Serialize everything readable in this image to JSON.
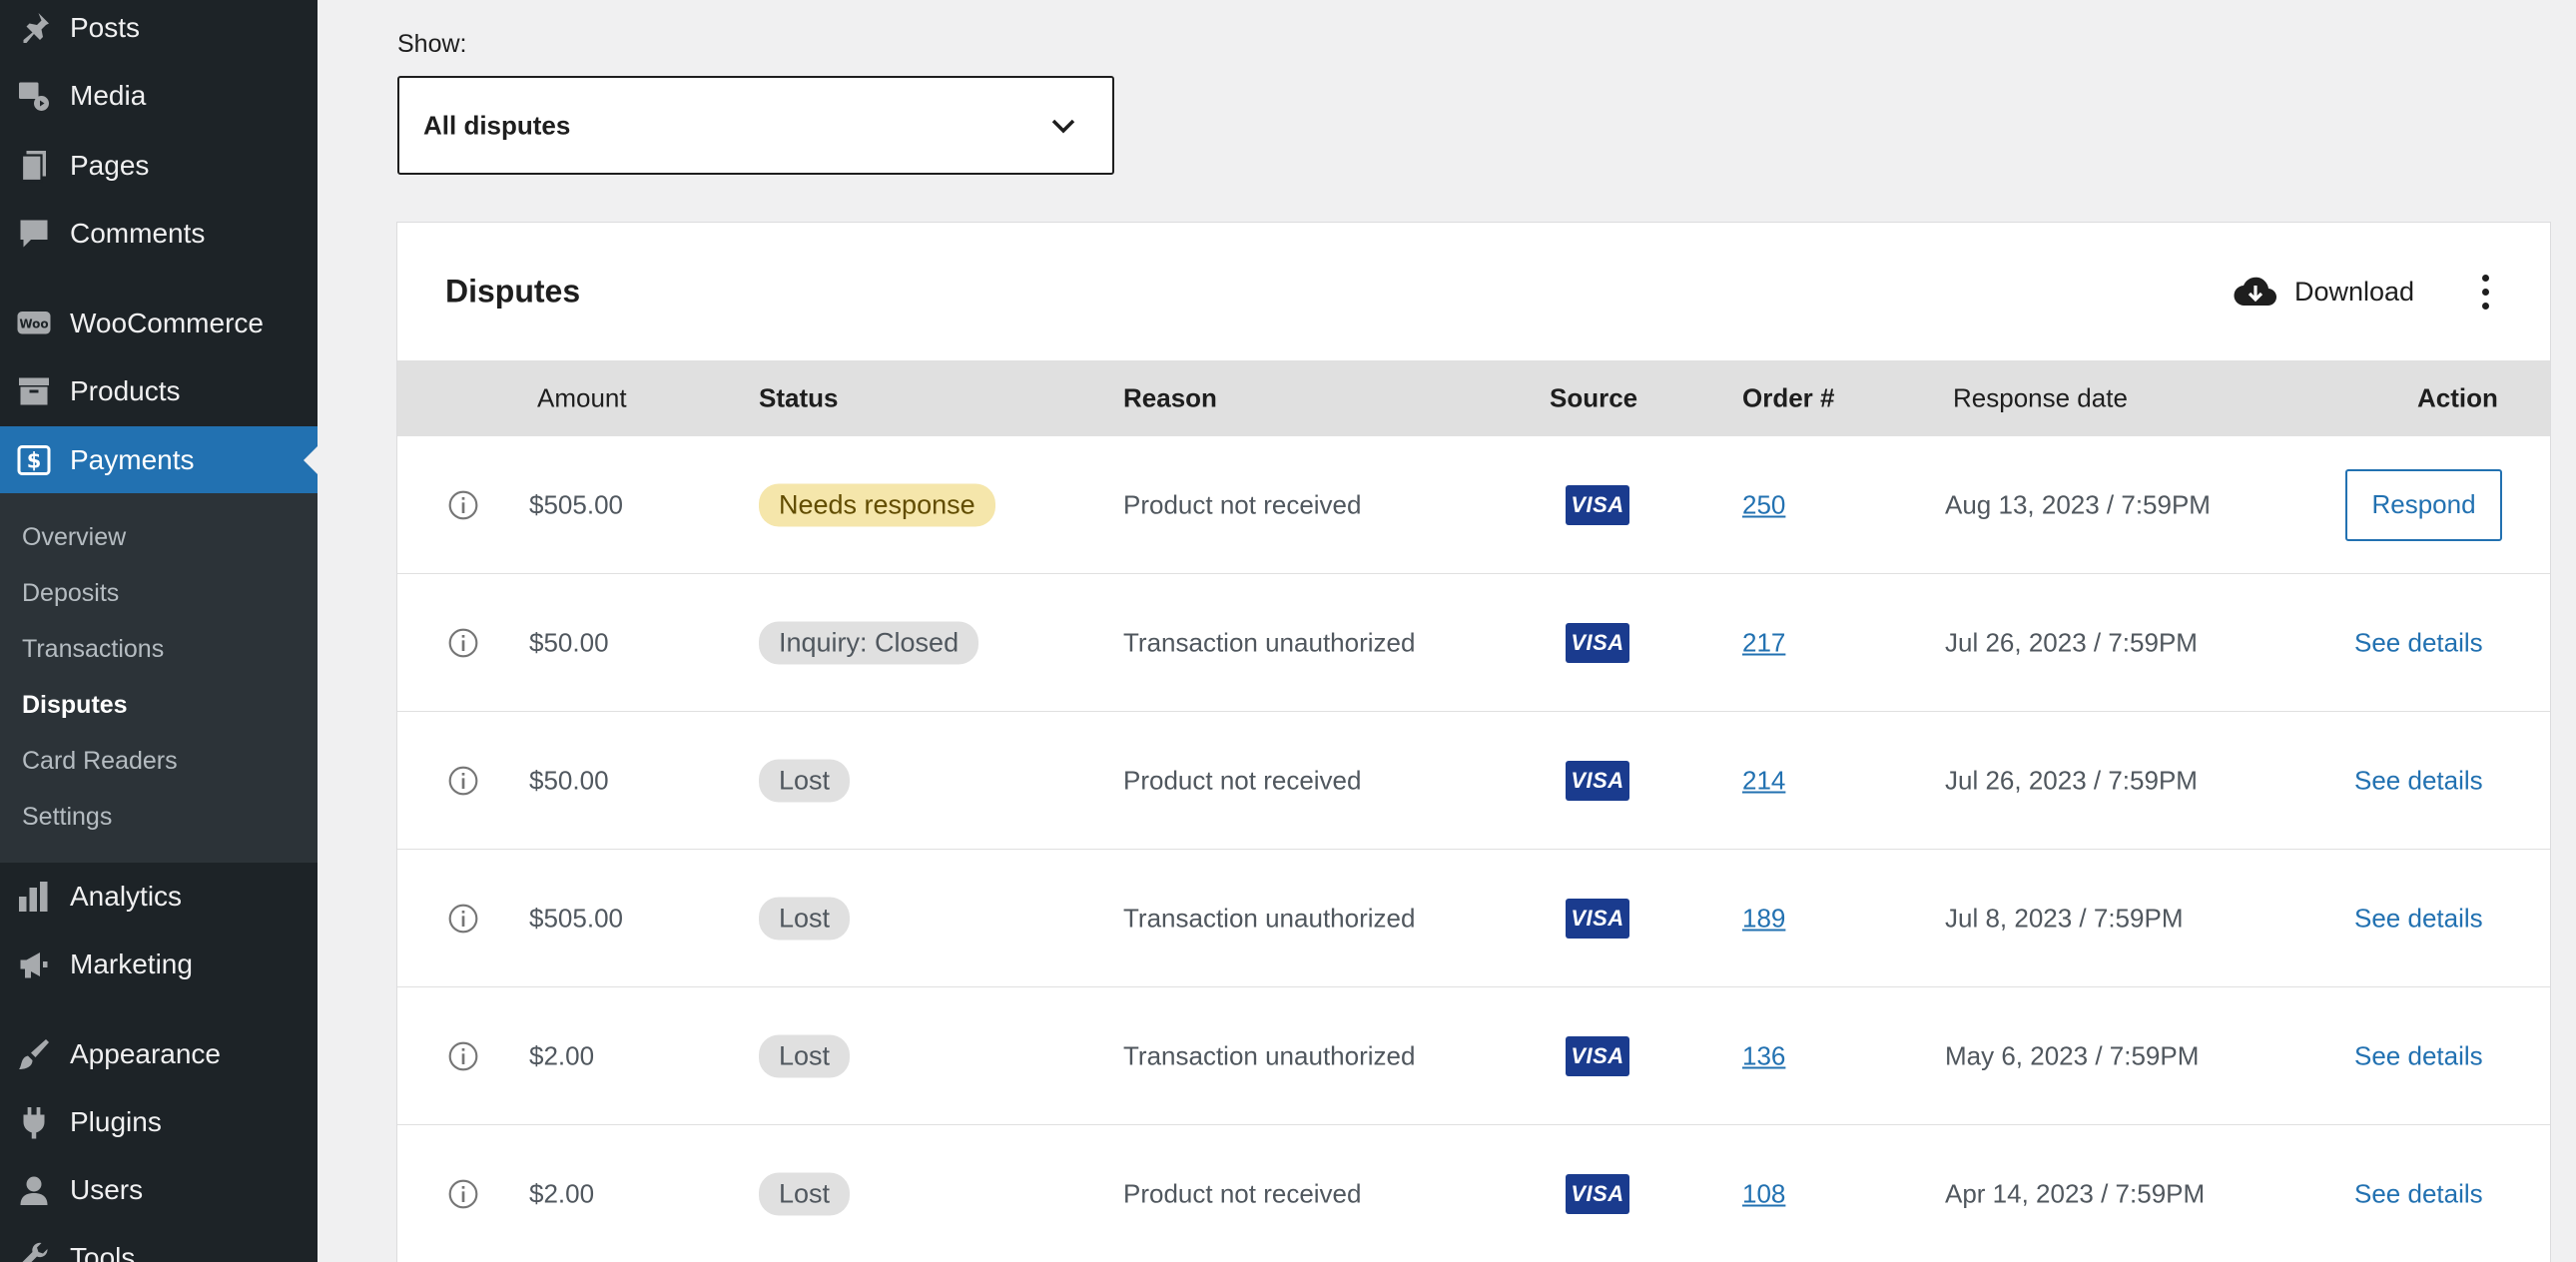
{
  "sidebar": {
    "menu": [
      {
        "label": "Posts",
        "icon": "pin-icon"
      },
      {
        "label": "Media",
        "icon": "media-icon"
      },
      {
        "label": "Pages",
        "icon": "pages-icon"
      },
      {
        "label": "Comments",
        "icon": "comment-icon"
      },
      {
        "label": "WooCommerce",
        "icon": "woo-icon"
      },
      {
        "label": "Products",
        "icon": "archive-icon"
      },
      {
        "label": "Payments",
        "icon": "dollar-icon"
      },
      {
        "label": "Analytics",
        "icon": "bar-chart-icon"
      },
      {
        "label": "Marketing",
        "icon": "megaphone-icon"
      },
      {
        "label": "Appearance",
        "icon": "brush-icon"
      },
      {
        "label": "Plugins",
        "icon": "plug-icon"
      },
      {
        "label": "Users",
        "icon": "user-icon"
      },
      {
        "label": "Tools",
        "icon": "wrench-icon"
      }
    ],
    "submenu": [
      "Overview",
      "Deposits",
      "Transactions",
      "Disputes",
      "Card Readers",
      "Settings"
    ],
    "accent_color": "#2271b1"
  },
  "filter": {
    "label": "Show:",
    "selected": "All disputes"
  },
  "card": {
    "title": "Disputes",
    "download_label": "Download"
  },
  "table": {
    "columns": [
      "Amount",
      "Status",
      "Reason",
      "Source",
      "Order #",
      "Response date",
      "Action"
    ],
    "rows": [
      {
        "amount": "$505.00",
        "status": "Needs response",
        "reason": "Product not received",
        "source": "VISA",
        "order": "250",
        "date": "Aug 13, 2023 / 7:59PM",
        "action": "Respond"
      },
      {
        "amount": "$50.00",
        "status": "Inquiry: Closed",
        "reason": "Transaction unauthorized",
        "source": "VISA",
        "order": "217",
        "date": "Jul 26, 2023 / 7:59PM",
        "action": "See details"
      },
      {
        "amount": "$50.00",
        "status": "Lost",
        "reason": "Product not received",
        "source": "VISA",
        "order": "214",
        "date": "Jul 26, 2023 / 7:59PM",
        "action": "See details"
      },
      {
        "amount": "$505.00",
        "status": "Lost",
        "reason": "Transaction unauthorized",
        "source": "VISA",
        "order": "189",
        "date": "Jul 8, 2023 / 7:59PM",
        "action": "See details"
      },
      {
        "amount": "$2.00",
        "status": "Lost",
        "reason": "Transaction unauthorized",
        "source": "VISA",
        "order": "136",
        "date": "May 6, 2023 / 7:59PM",
        "action": "See details"
      },
      {
        "amount": "$2.00",
        "status": "Lost",
        "reason": "Product not received",
        "source": "VISA",
        "order": "108",
        "date": "Apr 14, 2023 / 7:59PM",
        "action": "See details"
      }
    ]
  }
}
